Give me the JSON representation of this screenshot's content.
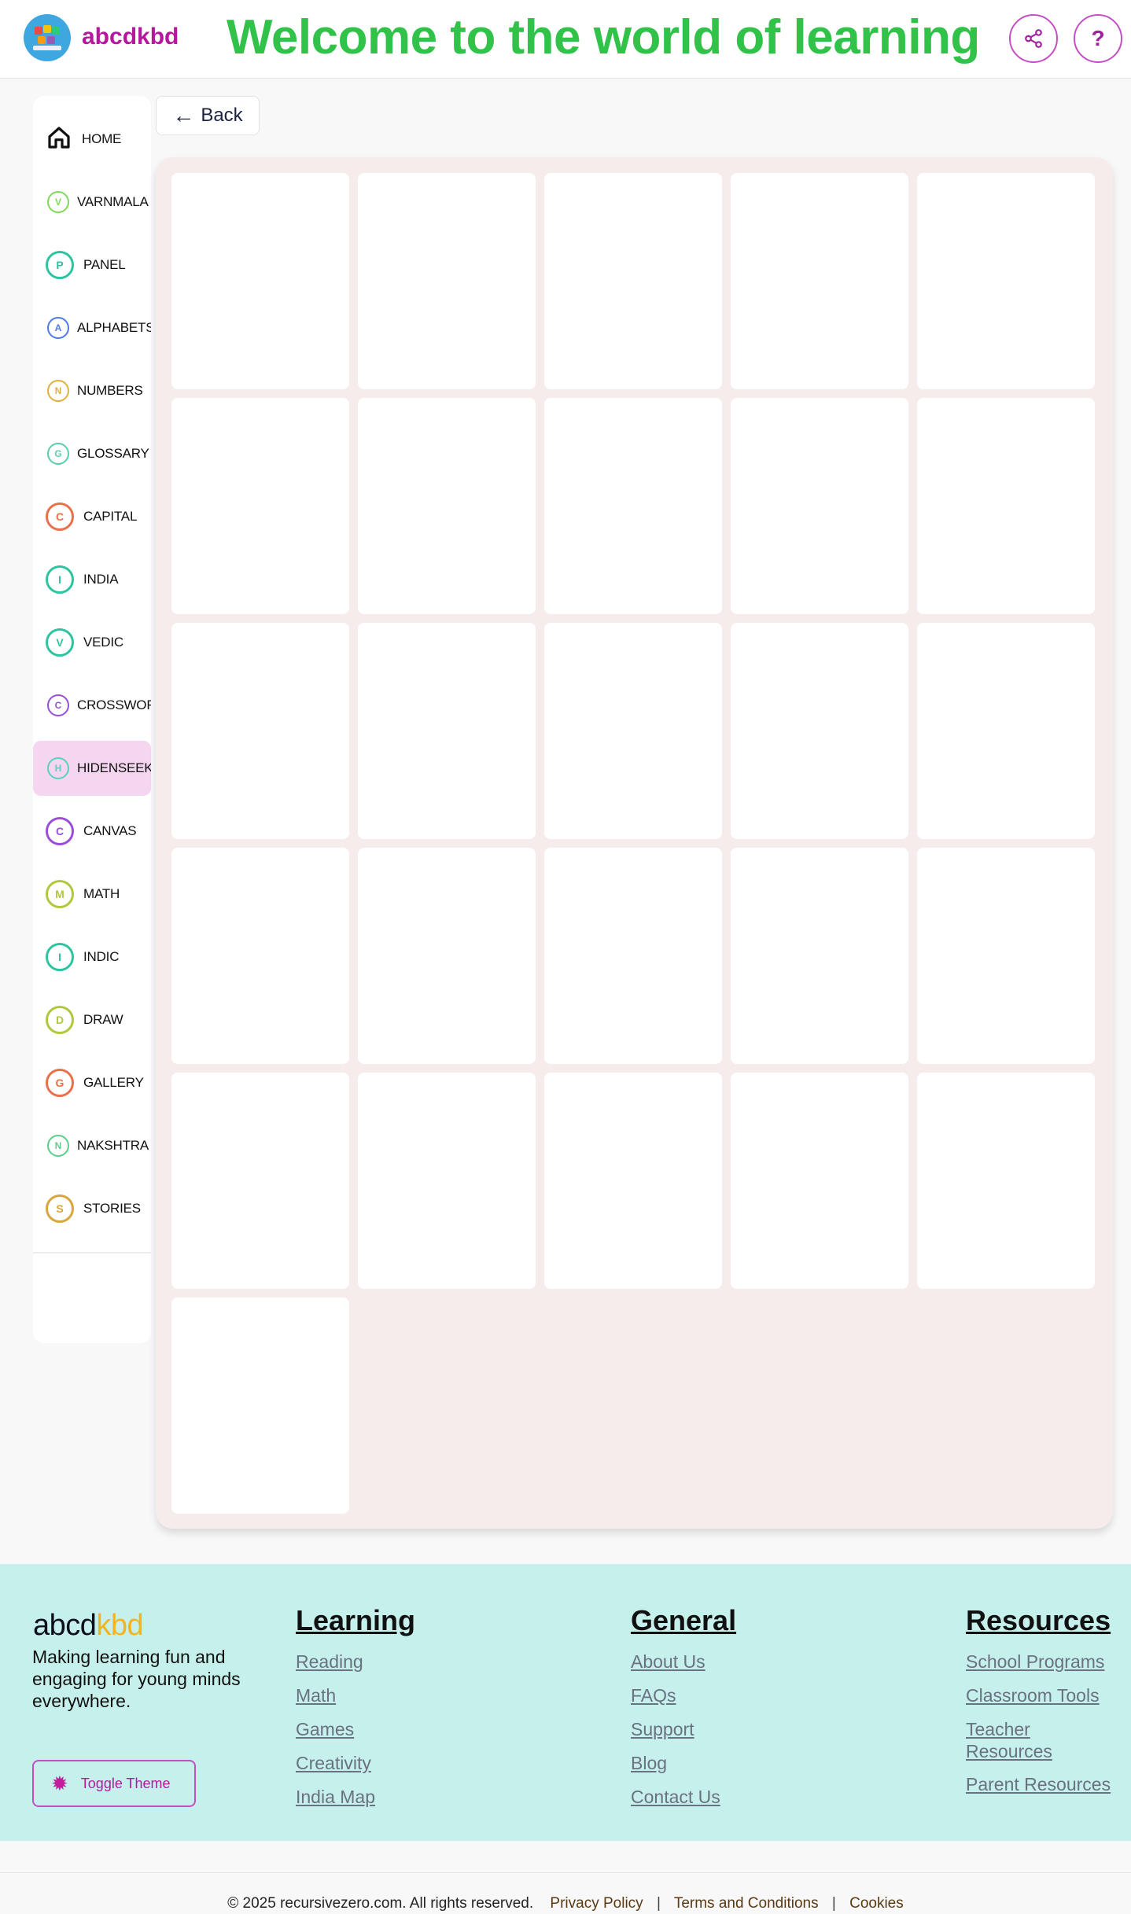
{
  "header": {
    "brand": "abcdkbd",
    "headline": "Welcome to the world of learning",
    "share_icon": "share-icon",
    "help_label": "?"
  },
  "sidebar": {
    "items": [
      {
        "label": "HOME",
        "icon": "home-icon",
        "letter": "",
        "color": "#111111"
      },
      {
        "label": "VARNMALA",
        "icon": "letter-v-icon",
        "letter": "V",
        "color": "#7fd95a"
      },
      {
        "label": "PANEL",
        "icon": "letter-p-icon",
        "letter": "P",
        "color": "#2ec4a0"
      },
      {
        "label": "ALPHABETS",
        "icon": "letter-a-icon",
        "letter": "A",
        "color": "#4f7be6"
      },
      {
        "label": "NUMBERS",
        "icon": "letter-n-icon",
        "letter": "N",
        "color": "#e0b040"
      },
      {
        "label": "GLOSSARY",
        "icon": "letter-g-icon",
        "letter": "G",
        "color": "#5ad0a6"
      },
      {
        "label": "CAPITAL",
        "icon": "letter-c-icon",
        "letter": "C",
        "color": "#e8704a"
      },
      {
        "label": "INDIA",
        "icon": "letter-i-icon",
        "letter": "I",
        "color": "#2ec4a0"
      },
      {
        "label": "VEDIC",
        "icon": "letter-v-icon",
        "letter": "V",
        "color": "#2ec4a0"
      },
      {
        "label": "CROSSWORD",
        "icon": "letter-c-icon",
        "letter": "C",
        "color": "#9b4fd8"
      },
      {
        "label": "HIDENSEEK",
        "icon": "letter-h-icon",
        "letter": "H",
        "color": "#5ad0c0"
      },
      {
        "label": "CANVAS",
        "icon": "letter-c-icon",
        "letter": "C",
        "color": "#9b4fd8"
      },
      {
        "label": "MATH",
        "icon": "letter-m-icon",
        "letter": "M",
        "color": "#b0c83c"
      },
      {
        "label": "INDIC",
        "icon": "letter-i-icon",
        "letter": "I",
        "color": "#2ec4a0"
      },
      {
        "label": "DRAW",
        "icon": "letter-d-icon",
        "letter": "D",
        "color": "#b0c83c"
      },
      {
        "label": "GALLERY",
        "icon": "letter-g-icon",
        "letter": "G",
        "color": "#e8704a"
      },
      {
        "label": "NAKSHTRA",
        "icon": "letter-n-icon",
        "letter": "N",
        "color": "#5ad08a"
      },
      {
        "label": "STORIES",
        "icon": "letter-s-icon",
        "letter": "S",
        "color": "#d8a63c"
      }
    ],
    "active": "HIDENSEEK",
    "active_bg": "#f5d6f0",
    "collapse_icon": "arrow-left-icon",
    "theme_icon": "sun-icon"
  },
  "main": {
    "back_label": "Back",
    "card_count": 26
  },
  "footer": {
    "brand_part1": "abcd",
    "brand_part2": "kbd",
    "tagline": "Making learning fun and engaging for young minds everywhere.",
    "toggle_theme_label": "Toggle Theme",
    "columns": [
      {
        "title": "Learning",
        "links": [
          "Reading",
          "Math",
          "Games",
          "Creativity",
          "India Map"
        ]
      },
      {
        "title": "General",
        "links": [
          "About Us",
          "FAQs",
          "Support",
          "Blog",
          "Contact Us"
        ]
      },
      {
        "title": "Resources",
        "links": [
          "School Programs",
          "Classroom Tools",
          "Teacher Resources",
          "Parent Resources"
        ]
      }
    ],
    "copyright": "© 2025 recursivezero.com. All rights reserved.",
    "legal_links": [
      "Privacy Policy",
      "Terms and Conditions",
      "Cookies"
    ]
  },
  "colors": {
    "accent": "#b5179e",
    "headline": "#31c24a",
    "footer_bg": "#c6f0eb",
    "panel_bg": "#f6eceb"
  }
}
